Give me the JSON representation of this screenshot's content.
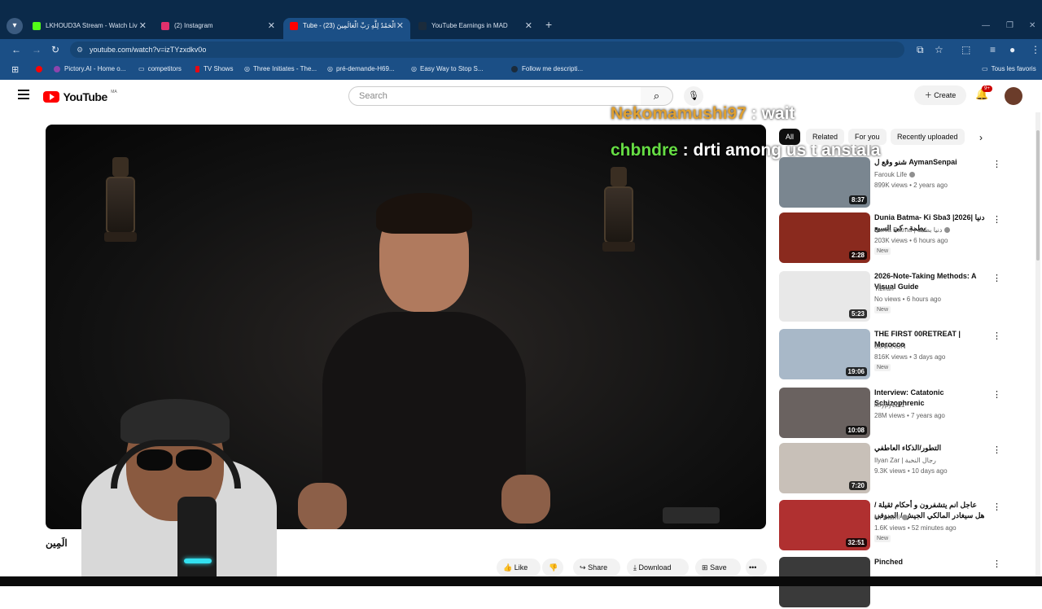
{
  "browser": {
    "tabs": [
      {
        "title": "LKHOUD3A Stream - Watch Liv",
        "color": "#53fc18"
      },
      {
        "title": "(2) Instagram",
        "color": "#e1306c"
      },
      {
        "title": "Tube - الْحَمْدُ لِلَّهِ رَبِّ الْعَالَمِينَ (23)",
        "color": "#ff0000"
      },
      {
        "title": "YouTube Earnings in MAD",
        "color": "#1b2b3b"
      }
    ],
    "new_tab": "+",
    "url": "youtube.com/watch?v=izTYzxdkv0o",
    "bookmarks": [
      {
        "label": "",
        "color": "#ff0000"
      },
      {
        "label": "Pictory.AI - Home o...",
        "color": "#8e44ad"
      },
      {
        "label": "competitors",
        "color": "#e5ecf5"
      },
      {
        "label": "TV Shows",
        "color": "#e50914"
      },
      {
        "label": "Three Initiates - The...",
        "color": "#e5ecf5"
      },
      {
        "label": "pré-demande-H69...",
        "color": "#e5ecf5"
      },
      {
        "label": "Easy Way to Stop S...",
        "color": "#e5ecf5"
      },
      {
        "label": "Follow me descripti...",
        "color": "#1b2b3b"
      }
    ],
    "all_bookmarks": "Tous les favoris"
  },
  "youtube": {
    "logo_text": "YouTube",
    "country": "MA",
    "search_placeholder": "Search",
    "create_label": "Create",
    "notif_count": "9+"
  },
  "chat": [
    {
      "user": "Nekomamushi97",
      "sep": " : ",
      "message": "wait"
    },
    {
      "user": "chbndre",
      "sep": " : ",
      "message": "drti among us t anstala"
    }
  ],
  "video": {
    "title_partial": "الَمِين"
  },
  "actions": {
    "like": "Like",
    "share": "Share",
    "download": "Download",
    "save": "Save",
    "more": "•••"
  },
  "chips": [
    "All",
    "Related",
    "For you",
    "Recently uploaded"
  ],
  "recommendations": [
    {
      "title": "شنو وقع ل AymanSenpai",
      "channel": "Farouk Life",
      "verified": true,
      "meta": "899K views • 2 years ago",
      "duration": "8:37",
      "new": false,
      "thumb": "#7a8690"
    },
    {
      "title": "Dunia Batma- Ki Sba3 |2026| دنيا بطمة - كي السبع",
      "channel": "Dunia Batma | دنيا بطمة",
      "verified": true,
      "meta": "203K views • 6 hours ago",
      "duration": "2:28",
      "new": true,
      "thumb": "#8a2a1e"
    },
    {
      "title": "2026-Note-Taking Methods: A Visual Guide",
      "channel": "Tiziran",
      "verified": false,
      "meta": "No views • 6 hours ago",
      "duration": "5:23",
      "new": true,
      "thumb": "#e8e8e8"
    },
    {
      "title": "THE FIRST 00RETREAT | Morocco",
      "channel": "00NATION",
      "verified": false,
      "meta": "816K views • 3 days ago",
      "duration": "19:06",
      "new": true,
      "thumb": "#a8b8c8"
    },
    {
      "title": "Interview: Catatonic Schizophrenic",
      "channel": "ktrypy1111",
      "verified": false,
      "meta": "28M views • 7 years ago",
      "duration": "10:08",
      "new": false,
      "thumb": "#6a6260"
    },
    {
      "title": "التطور/الذكاء العاطفي",
      "channel": "Ilyan Zar | رجال النخبة",
      "verified": false,
      "meta": "9.3K views • 10 days ago",
      "duration": "7:20",
      "new": false,
      "thumb": "#c8c0b8"
    },
    {
      "title": "عاجل انم يتشفرون و أحكام ثقيلة / هل سيغادر المالكي الجيش / الصوفي يرفض ...",
      "channel": "Mr Alami",
      "verified": true,
      "meta": "1.6K views • 52 minutes ago",
      "duration": "32:51",
      "new": true,
      "thumb": "#b03030"
    },
    {
      "title": "Pinched",
      "channel": "",
      "verified": false,
      "meta": "",
      "duration": "",
      "new": false,
      "thumb": "#3a3a3a"
    }
  ],
  "new_badge": "New"
}
